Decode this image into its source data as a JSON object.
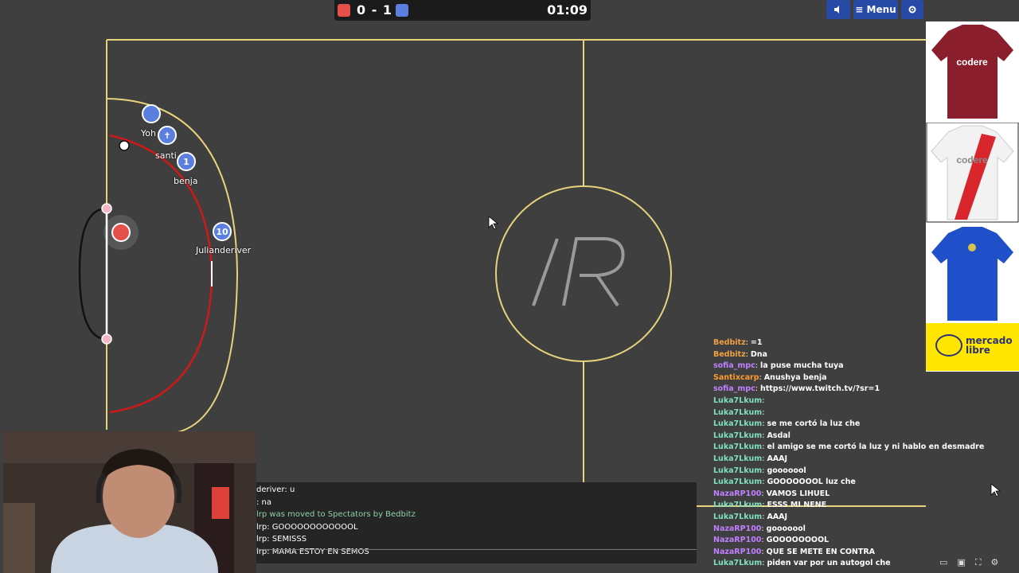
{
  "scoreboard": {
    "score": "0 - 1",
    "timer": "01:09",
    "red_color": "#e5514a",
    "blue_color": "#5a7fe0"
  },
  "controls": {
    "sound_icon": "speaker-icon",
    "menu_label": "≡ Menu",
    "gear_icon": "gear-icon"
  },
  "field": {
    "center_logo": "/R",
    "line_color": "#e8d27a",
    "goal_line_color": "#cc1a1a"
  },
  "players": [
    {
      "name": "Yoh",
      "number": "",
      "team": "blue"
    },
    {
      "name": "santi",
      "number": "✝",
      "team": "blue"
    },
    {
      "name": "benja",
      "number": "1",
      "team": "blue"
    },
    {
      "name": "Julianderiver",
      "number": "10",
      "team": "blue"
    },
    {
      "name": "",
      "number": "",
      "team": "red"
    }
  ],
  "sponsors": {
    "logo_text_1": "mercado",
    "logo_text_2": "libre",
    "shirt_brand": "codere"
  },
  "chat_left": [
    {
      "text": "deriver: u",
      "type": "msg"
    },
    {
      "text": ": na",
      "type": "msg"
    },
    {
      "text": "lrp was moved to Spectators by Bedbitz",
      "type": "sys"
    },
    {
      "text": "lrp: GOOOOOOOOOOOOL",
      "type": "msg"
    },
    {
      "text": "lrp: SEMISSS",
      "type": "msg"
    },
    {
      "text": "lrp: MAMA ESTOY EN SEMOS",
      "type": "msg"
    }
  ],
  "chat_right": [
    {
      "user": "Bedbitz",
      "color": "#f0a040",
      "text": "=1"
    },
    {
      "user": "Bedbitz",
      "color": "#f0a040",
      "text": "Dna"
    },
    {
      "user": "sofia_mpc",
      "color": "#c080ff",
      "text": "la puse mucha tuya"
    },
    {
      "user": "Santixcarp",
      "color": "#ff9a2e",
      "text": "Anushya benja"
    },
    {
      "user": "sofia_mpc",
      "color": "#c080ff",
      "text": "https://www.twitch.tv/?sr=1"
    },
    {
      "user": "Luka7Lkum",
      "color": "#7fe0c0",
      "text": ""
    },
    {
      "user": "Luka7Lkum",
      "color": "#7fe0c0",
      "text": ""
    },
    {
      "user": "Luka7Lkum",
      "color": "#7fe0c0",
      "text": "se me cortó la luz che"
    },
    {
      "user": "Luka7Lkum",
      "color": "#7fe0c0",
      "text": "Asdal"
    },
    {
      "user": "Luka7Lkum",
      "color": "#7fe0c0",
      "text": "el amigo se me cortó la luz y ni hablo en desmadre"
    },
    {
      "user": "Luka7Lkum",
      "color": "#7fe0c0",
      "text": "AAAJ"
    },
    {
      "user": "Luka7Lkum",
      "color": "#7fe0c0",
      "text": "gooooool"
    },
    {
      "user": "Luka7Lkum",
      "color": "#7fe0c0",
      "text": "GOOOOOOOL luz che"
    },
    {
      "user": "NazaRP100",
      "color": "#c080ff",
      "text": "VAMOS LIHUEL"
    },
    {
      "user": "Luka7Lkum",
      "color": "#7fe0c0",
      "text": "ESSS MI NENE"
    },
    {
      "user": "Luka7Lkum",
      "color": "#7fe0c0",
      "text": "AAAJ"
    },
    {
      "user": "NazaRP100",
      "color": "#c080ff",
      "text": "gooooool"
    },
    {
      "user": "NazaRP100",
      "color": "#c080ff",
      "text": "GOOOOOOOOL"
    },
    {
      "user": "NazaRP100",
      "color": "#c080ff",
      "text": "QUE SE METE EN CONTRA"
    },
    {
      "user": "Luka7Lkum",
      "color": "#7fe0c0",
      "text": "piden var por un autogol che"
    }
  ]
}
